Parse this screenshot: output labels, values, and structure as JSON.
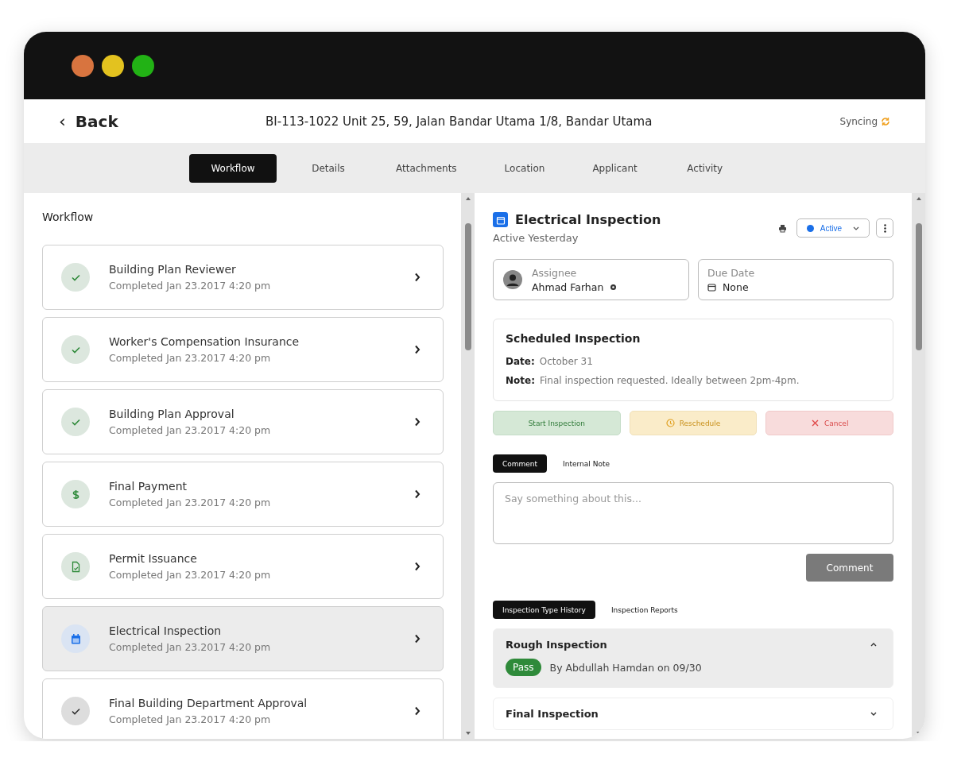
{
  "window": {
    "controls": [
      {
        "color": "#d8743f"
      },
      {
        "color": "#e3c21f"
      },
      {
        "color": "#22b215"
      }
    ]
  },
  "header": {
    "back": {
      "icon": "‹",
      "label": "Back"
    },
    "title": "BI-113-1022 Unit 25, 59, Jalan Bandar Utama 1/8, Bandar Utama",
    "sync": {
      "label": "Syncing"
    }
  },
  "tabs": [
    {
      "label": "Workflow",
      "selected": true
    },
    {
      "label": "Details",
      "selected": false
    },
    {
      "label": "Attachments",
      "selected": false
    },
    {
      "label": "Location",
      "selected": false
    },
    {
      "label": "Applicant",
      "selected": false
    },
    {
      "label": "Activity",
      "selected": false
    }
  ],
  "workflow": {
    "title": "Workflow",
    "items": [
      {
        "kind": "check",
        "color": "#2f8a3a",
        "title": "Building Plan Reviewer",
        "subtitle": "Completed Jan 23.2017 4:20 pm",
        "selected": false
      },
      {
        "kind": "check",
        "color": "#2f8a3a",
        "title": "Worker's Compensation Insurance",
        "subtitle": "Completed Jan 23.2017 4:20 pm",
        "selected": false
      },
      {
        "kind": "check",
        "color": "#2f8a3a",
        "title": "Building Plan Approval",
        "subtitle": "Completed Jan 23.2017 4:20 pm",
        "selected": false
      },
      {
        "kind": "dollar",
        "color": "#2f8a3a",
        "title": "Final Payment",
        "subtitle": "Completed Jan 23.2017 4:20 pm",
        "selected": false
      },
      {
        "kind": "document",
        "color": "#2f8a3a",
        "title": "Permit Issuance",
        "subtitle": "Completed Jan 23.2017 4:20 pm",
        "selected": false
      },
      {
        "kind": "calendar",
        "color": "#1a6fe8",
        "title": "Electrical Inspection",
        "subtitle": "Completed Jan 23.2017 4:20 pm",
        "selected": true
      },
      {
        "kind": "check",
        "color": "#333333",
        "title": "Final Building Department Approval",
        "subtitle": "Completed Jan 23.2017 4:20 pm",
        "selected": false
      }
    ]
  },
  "detail": {
    "title": "Electrical Inspection",
    "subtitle": "Active Yesterday",
    "status": {
      "label": "Active",
      "color": "#1a6fe8"
    },
    "assignee": {
      "label": "Assignee",
      "value": "Ahmad Farhan"
    },
    "due_date": {
      "label": "Due Date",
      "value": "None"
    },
    "scheduled": {
      "title": "Scheduled Inspection",
      "rows": [
        {
          "label": "Date:",
          "value": "October 31"
        },
        {
          "label": "Note:",
          "value": "Final inspection requested. Ideally between 2pm-4pm."
        }
      ]
    },
    "actions": [
      {
        "kind": "start",
        "label": "Start Inspection"
      },
      {
        "kind": "reschedule",
        "label": "Reschedule"
      },
      {
        "kind": "cancel",
        "label": "Cancel"
      }
    ],
    "comment_tabs": [
      {
        "label": "Comment",
        "selected": true
      },
      {
        "label": "Internal Note",
        "selected": false
      }
    ],
    "comment": {
      "placeholder": "Say something about this...",
      "button": "Comment"
    },
    "history_tabs": [
      {
        "label": "Inspection Type History",
        "selected": true
      },
      {
        "label": "Inspection Reports",
        "selected": false
      }
    ],
    "history": [
      {
        "title": "Rough Inspection",
        "expanded": true,
        "result": "Pass",
        "by": "By Abdullah Hamdan on 09/30"
      },
      {
        "title": "Final Inspection",
        "expanded": false
      }
    ]
  }
}
